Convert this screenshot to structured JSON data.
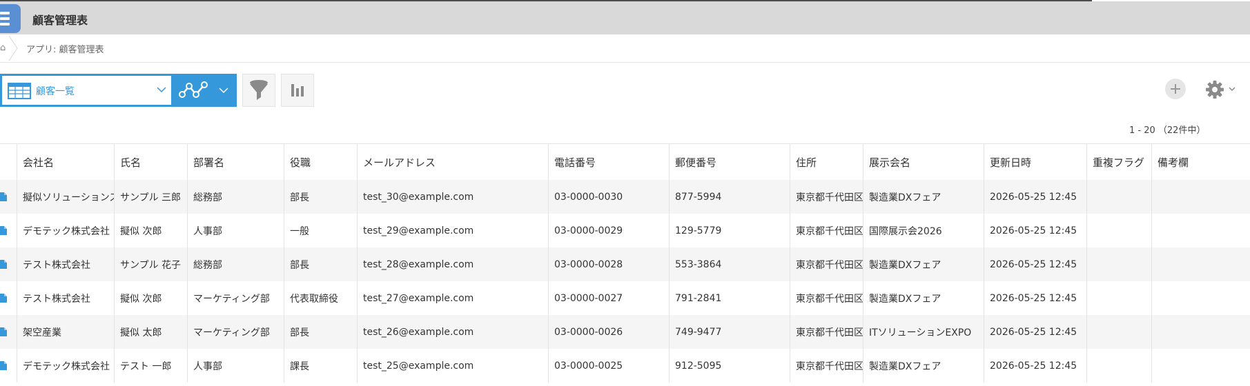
{
  "app": {
    "title": "顧客管理表",
    "breadcrumb": "アプリ: 顧客管理表"
  },
  "toolbar": {
    "view_name": "顧客一覧"
  },
  "pagination": {
    "text": "1 - 20 （22件中）"
  },
  "colors": {
    "accent": "#3498db",
    "appbar": "#d9d9d9",
    "app_icon": "#5b8fd4"
  },
  "icons": [
    "menu-icon",
    "home-icon",
    "table-view-icon",
    "graph-icon",
    "filter-icon",
    "chart-icon",
    "add-icon",
    "gear-icon",
    "record-icon"
  ],
  "table": {
    "columns": [
      "会社名",
      "氏名",
      "部署名",
      "役職",
      "メールアドレス",
      "電話番号",
      "郵便番号",
      "住所",
      "展示会名",
      "更新日時",
      "重複フラグ",
      "備考欄"
    ],
    "rows": [
      [
        "擬似ソリューションズ",
        "サンプル 三郎",
        "総務部",
        "部長",
        "test_30@example.com",
        "03-0000-0030",
        "877-5994",
        "東京都千代田区",
        "製造業DXフェア",
        "2026-05-25 12:45",
        "",
        ""
      ],
      [
        "デモテック株式会社",
        "擬似 次郎",
        "人事部",
        "一般",
        "test_29@example.com",
        "03-0000-0029",
        "129-5779",
        "東京都千代田区",
        "国際展示会2026",
        "2026-05-25 12:45",
        "",
        ""
      ],
      [
        "テスト株式会社",
        "サンプル 花子",
        "総務部",
        "部長",
        "test_28@example.com",
        "03-0000-0028",
        "553-3864",
        "東京都千代田区",
        "製造業DXフェア",
        "2026-05-25 12:45",
        "",
        ""
      ],
      [
        "テスト株式会社",
        "擬似 次郎",
        "マーケティング部",
        "代表取締役",
        "test_27@example.com",
        "03-0000-0027",
        "791-2841",
        "東京都千代田区",
        "製造業DXフェア",
        "2026-05-25 12:45",
        "",
        ""
      ],
      [
        "架空産業",
        "擬似 太郎",
        "マーケティング部",
        "部長",
        "test_26@example.com",
        "03-0000-0026",
        "749-9477",
        "東京都千代田区",
        "ITソリューションEXPO",
        "2026-05-25 12:45",
        "",
        ""
      ],
      [
        "デモテック株式会社",
        "テスト 一郎",
        "人事部",
        "課長",
        "test_25@example.com",
        "03-0000-0025",
        "912-5095",
        "東京都千代田区",
        "製造業DXフェア",
        "2026-05-25 12:45",
        "",
        ""
      ]
    ]
  }
}
